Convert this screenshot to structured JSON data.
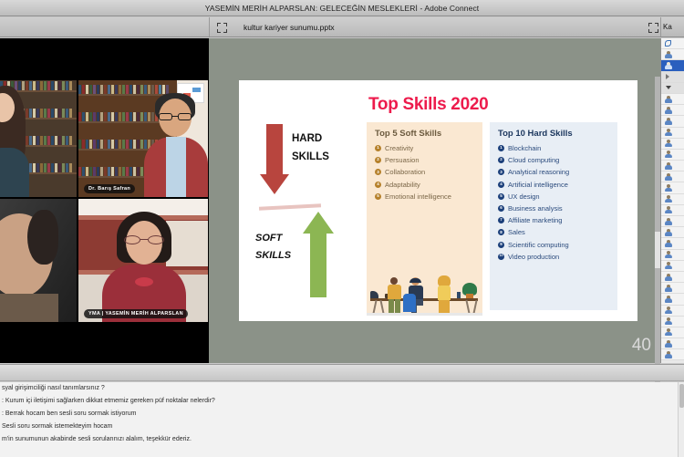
{
  "window": {
    "title": "YASEMİN MERİH ALPARSLAN: GELECEĞİN MESLEKLERİ - Adobe Connect"
  },
  "share_pod": {
    "filename": "kultur kariyer sunumu.pptx",
    "fullscreen_icon": "fullscreen-icon",
    "slide_number": "40"
  },
  "video_pod": {
    "fullscreen_icon": "fullscreen-icon",
    "participants": [
      {
        "name": "",
        "label_visible": false
      },
      {
        "name": "Dr. Barış Safran",
        "label_visible": true
      },
      {
        "name": "",
        "label_visible": false
      },
      {
        "name": "YMA | YASEMİN MERİH ALPARSLAN",
        "label_visible": true
      }
    ]
  },
  "attendee_panel": {
    "title": "Ka",
    "rows": [
      {
        "icon": "phone-icon",
        "selected": false
      },
      {
        "icon": "user-icon",
        "selected": false
      },
      {
        "icon": "user-icon",
        "selected": true
      },
      {
        "icon": "chevron-right-icon",
        "selected": false
      },
      {
        "icon": "chevron-down-icon",
        "selected": false
      },
      {
        "icon": "user-icon",
        "selected": false
      },
      {
        "icon": "user-icon",
        "selected": false
      },
      {
        "icon": "user-icon",
        "selected": false
      },
      {
        "icon": "user-icon",
        "selected": false
      },
      {
        "icon": "user-icon",
        "selected": false
      },
      {
        "icon": "user-icon",
        "selected": false
      },
      {
        "icon": "user-icon",
        "selected": false
      },
      {
        "icon": "user-icon",
        "selected": false
      },
      {
        "icon": "user-icon",
        "selected": false
      },
      {
        "icon": "user-icon",
        "selected": false
      },
      {
        "icon": "user-icon",
        "selected": false
      },
      {
        "icon": "user-icon",
        "selected": false
      },
      {
        "icon": "user-icon",
        "selected": false
      },
      {
        "icon": "user-icon",
        "selected": false
      },
      {
        "icon": "user-icon",
        "selected": false
      },
      {
        "icon": "user-icon",
        "selected": false
      },
      {
        "icon": "user-icon",
        "selected": false
      },
      {
        "icon": "user-icon",
        "selected": false
      },
      {
        "icon": "user-icon",
        "selected": false
      },
      {
        "icon": "user-icon",
        "selected": false
      },
      {
        "icon": "user-icon",
        "selected": false
      },
      {
        "icon": "user-icon",
        "selected": false
      },
      {
        "icon": "user-icon",
        "selected": false
      },
      {
        "icon": "user-icon",
        "selected": false
      }
    ]
  },
  "slide": {
    "title": "Top Skills 2020",
    "hard_label_line1": "HARD",
    "hard_label_line2": "SKILLS",
    "soft_label_line1": "SOFT",
    "soft_label_line2": "SKILLS",
    "soft_card": {
      "heading": "Top 5 Soft Skills",
      "items": [
        {
          "n": "1",
          "label": "Creativity"
        },
        {
          "n": "2",
          "label": "Persuasion"
        },
        {
          "n": "3",
          "label": "Collaboration"
        },
        {
          "n": "4",
          "label": "Adaptability"
        },
        {
          "n": "5",
          "label": "Emotional intelligence"
        }
      ]
    },
    "hard_card": {
      "heading": "Top 10 Hard Skills",
      "items": [
        {
          "n": "1",
          "label": "Blockchain"
        },
        {
          "n": "2",
          "label": "Cloud computing"
        },
        {
          "n": "3",
          "label": "Analytical reasoning"
        },
        {
          "n": "4",
          "label": "Artificial intelligence"
        },
        {
          "n": "5",
          "label": "UX design"
        },
        {
          "n": "6",
          "label": "Business analysis"
        },
        {
          "n": "7",
          "label": "Affiliate marketing"
        },
        {
          "n": "8",
          "label": "Sales"
        },
        {
          "n": "9",
          "label": "Scientific computing"
        },
        {
          "n": "10",
          "label": "Video production"
        }
      ]
    },
    "colors": {
      "title": "#ed1b4c",
      "hard_arrow": "#b8453e",
      "soft_arrow": "#8cb653",
      "soft_card_bg": "#fae8d2",
      "hard_card_bg": "#e8eef5"
    }
  },
  "chat": {
    "messages": [
      "syal girişimciliği nasıl tanımlarsınız ?",
      ": Kurum içi  iletişimi sağlarken dikkat etmemiz gereken püf noktalar nelerdir?",
      ": Berrak hocam ben sesli soru sormak istiyorum",
      "Sesli soru sormak istemekteyim hocam",
      "m'in sunumunun akabinde sesli sorularınızı alalım, teşekkür ederiz."
    ]
  }
}
